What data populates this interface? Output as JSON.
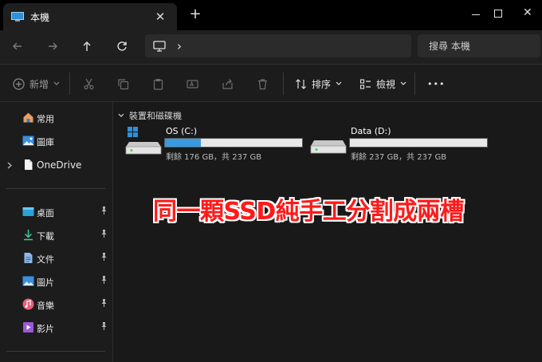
{
  "window": {
    "tab_title": "本機",
    "tab_close": "✕",
    "new_tab": "+",
    "minimize": "",
    "close": "✕"
  },
  "address": {
    "chevron": "›",
    "search_placeholder": "搜尋 本機"
  },
  "commandbar": {
    "new_label": "新增",
    "sort_label": "排序",
    "view_label": "檢視",
    "more": "•••"
  },
  "sidebar": {
    "items": [
      {
        "label": "常用",
        "icon": "home-icon"
      },
      {
        "label": "圖庫",
        "icon": "gallery-icon"
      },
      {
        "label": "OneDrive",
        "icon": "onedrive-icon"
      },
      {
        "label": "桌面",
        "icon": "desktop-icon"
      },
      {
        "label": "下載",
        "icon": "download-icon"
      },
      {
        "label": "文件",
        "icon": "documents-icon"
      },
      {
        "label": "圖片",
        "icon": "pictures-icon"
      },
      {
        "label": "音樂",
        "icon": "music-icon"
      },
      {
        "label": "影片",
        "icon": "videos-icon"
      }
    ],
    "pin": "📌"
  },
  "main": {
    "group_header": "裝置和磁碟機",
    "drives": [
      {
        "name": "OS (C:)",
        "info": "剩餘 176 GB，共 237 GB",
        "used_fraction": 0.26
      },
      {
        "name": "Data (D:)",
        "info": "剩餘 237 GB，共 237 GB",
        "used_fraction": 0.0
      }
    ]
  },
  "overlay_text": "同一顆SSD純手工分割成兩槽",
  "colors": {
    "accent": "#3a9ae0",
    "overlay_text": "#ff1a1a"
  }
}
